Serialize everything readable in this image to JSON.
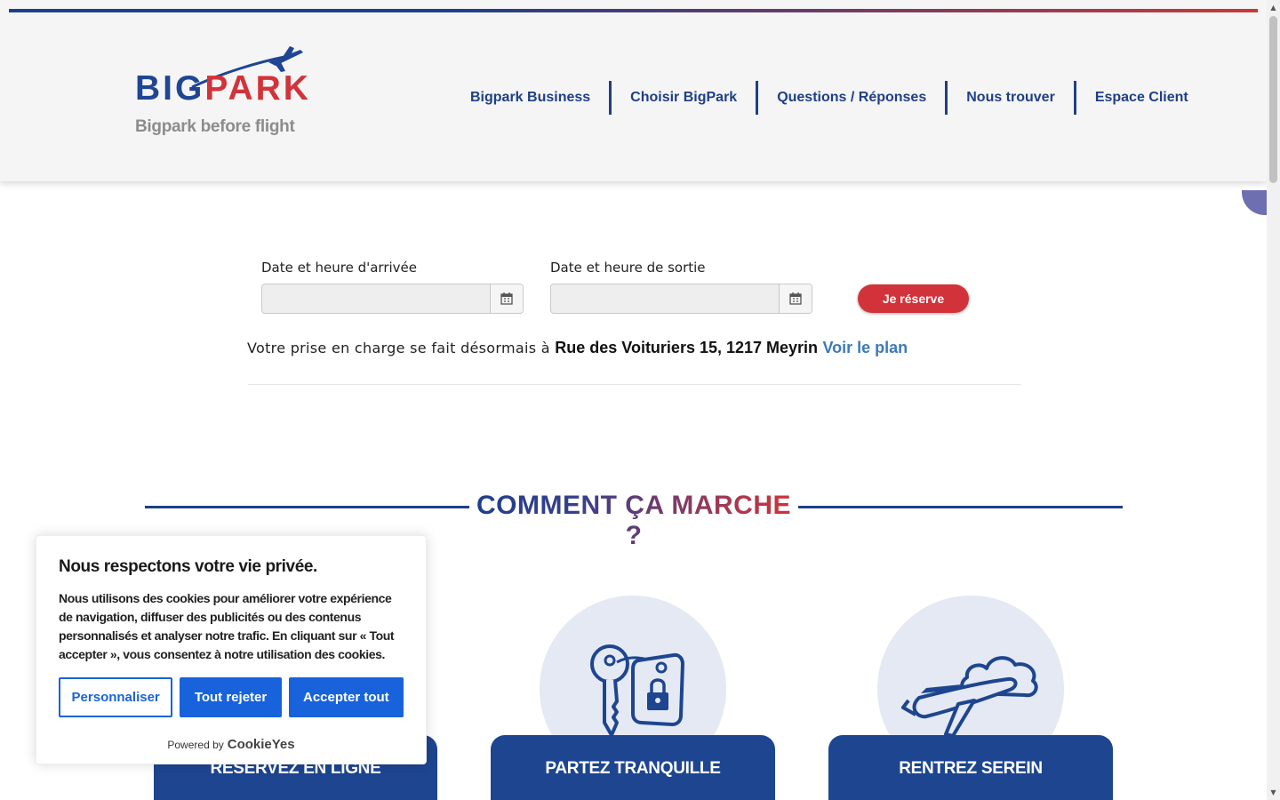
{
  "header": {
    "logo": {
      "word_big": "BIG",
      "word_park": "PARK",
      "tagline": "Bigpark before flight"
    },
    "nav": [
      {
        "label": "Bigpark Business"
      },
      {
        "label": "Choisir BigPark"
      },
      {
        "label": "Questions / Réponses"
      },
      {
        "label": "Nous trouver"
      },
      {
        "label": "Espace Client"
      }
    ]
  },
  "booking": {
    "arrival_label": "Date et heure d'arrivée",
    "arrival_value": "",
    "departure_label": "Date et heure de sortie",
    "departure_value": "",
    "calendar_icon": "calendar-icon",
    "submit_label": "Je réserve",
    "pickup_text": "Votre prise en charge se fait désormais à",
    "pickup_address": "Rue des Voituriers 15, 1217 Meyrin",
    "map_link": "Voir le plan"
  },
  "how_it_works": {
    "title": "COMMENT ÇA MARCHE ?",
    "steps": [
      {
        "label": "RÉSERVEZ EN LIGNE",
        "icon": "laptop-icon"
      },
      {
        "label": "PARTEZ TRANQUILLE",
        "icon": "key-tag-icon"
      },
      {
        "label": "RENTREZ SEREIN",
        "icon": "plane-cloud-icon"
      }
    ]
  },
  "cookie_banner": {
    "title": "Nous respectons votre vie privée.",
    "text": "Nous utilisons des cookies pour améliorer votre expérience de navigation, diffuser des publicités ou des contenus personnalisés et analyser notre trafic. En cliquant sur « Tout accepter », vous consentez à notre utilisation des cookies.",
    "customize_label": "Personnaliser",
    "reject_label": "Tout rejeter",
    "accept_label": "Accepter tout",
    "powered_by": "Powered by",
    "brand": "CookieYes"
  },
  "colors": {
    "brand_blue": "#1f3f85",
    "brand_red": "#d2333a",
    "cookie_blue": "#1863dc",
    "link_blue": "#3d7ab8"
  }
}
